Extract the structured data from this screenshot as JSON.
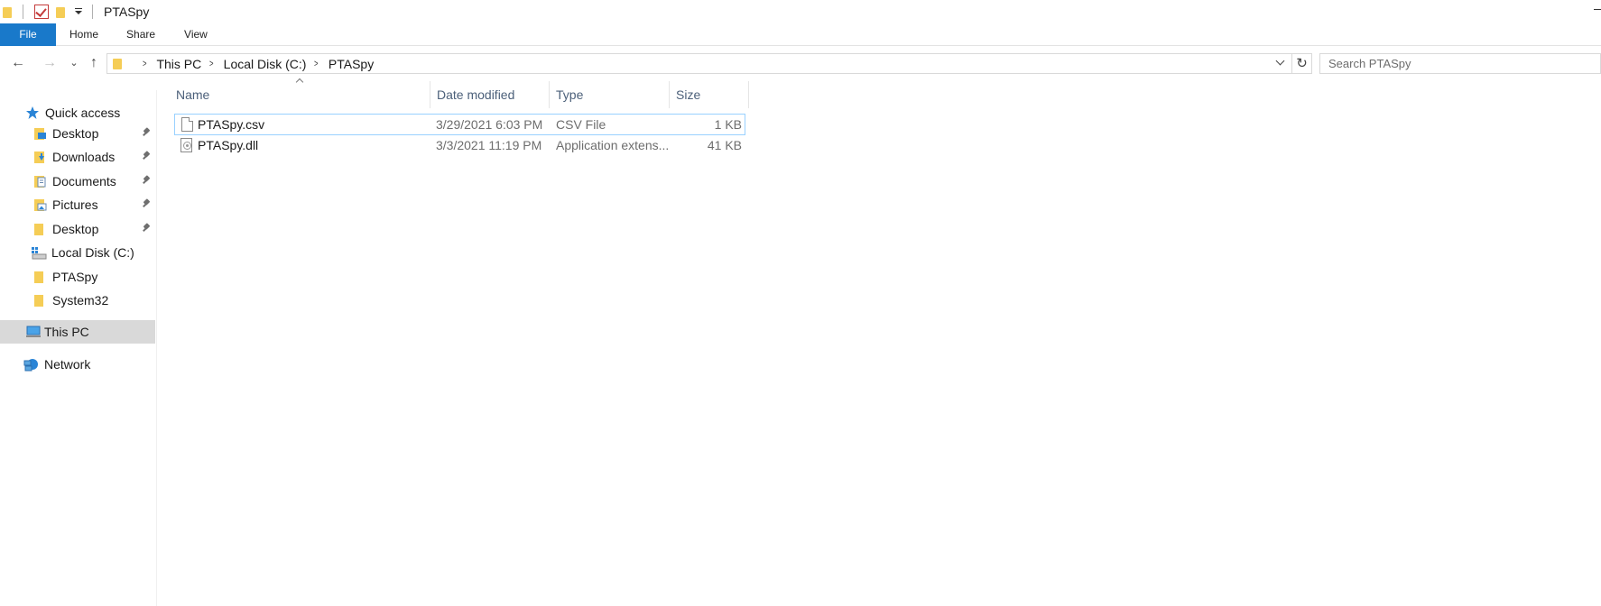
{
  "window": {
    "title": "PTASpy"
  },
  "ribbon": {
    "tabs": [
      {
        "label": "File"
      },
      {
        "label": "Home"
      },
      {
        "label": "Share"
      },
      {
        "label": "View"
      }
    ]
  },
  "address": {
    "crumbs": [
      "This PC",
      "Local Disk (C:)",
      "PTASpy"
    ],
    "search_placeholder": "Search PTASpy"
  },
  "sidebar": {
    "items": [
      {
        "label": "Quick access",
        "icon": "star-icon"
      },
      {
        "label": "Desktop",
        "icon": "desktop-folder-icon",
        "pinned": true
      },
      {
        "label": "Downloads",
        "icon": "downloads-folder-icon",
        "pinned": true
      },
      {
        "label": "Documents",
        "icon": "documents-folder-icon",
        "pinned": true
      },
      {
        "label": "Pictures",
        "icon": "pictures-folder-icon",
        "pinned": true
      },
      {
        "label": "Desktop",
        "icon": "folder-icon",
        "pinned": true
      },
      {
        "label": "Local Disk (C:)",
        "icon": "drive-icon"
      },
      {
        "label": "PTASpy",
        "icon": "folder-icon"
      },
      {
        "label": "System32",
        "icon": "folder-icon"
      },
      {
        "label": "This PC",
        "icon": "computer-icon",
        "selected": true
      },
      {
        "label": "Network",
        "icon": "network-icon"
      }
    ]
  },
  "files": {
    "columns": [
      "Name",
      "Date modified",
      "Type",
      "Size"
    ],
    "rows": [
      {
        "name": "PTASpy.csv",
        "date": "3/29/2021 6:03 PM",
        "type": "CSV File",
        "size": "1 KB",
        "selected": true
      },
      {
        "name": "PTASpy.dll",
        "date": "3/3/2021 11:19 PM",
        "type": "Application extens...",
        "size": "41 KB"
      }
    ]
  },
  "colors": {
    "accent": "#1979ca",
    "folder": "#f5cd56",
    "selection_border": "#99d1ff",
    "sidebar_selected": "#d9d9d9",
    "column_header_text": "#4c607a"
  }
}
